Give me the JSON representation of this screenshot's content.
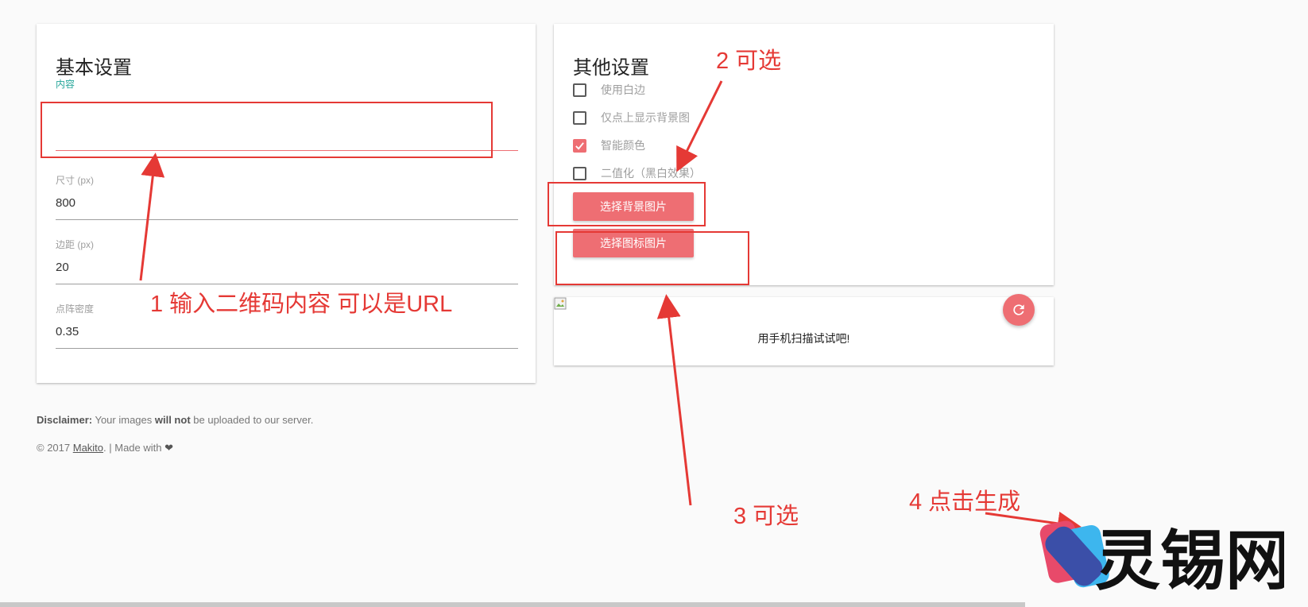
{
  "basic": {
    "title": "基本设置",
    "subtitle": "内容",
    "content_value": "",
    "size_label": "尺寸 (px)",
    "size_value": "800",
    "margin_label": "边距 (px)",
    "margin_value": "20",
    "density_label": "点阵密度",
    "density_value": "0.35"
  },
  "other": {
    "title": "其他设置",
    "options": [
      {
        "label": "使用白边",
        "checked": false
      },
      {
        "label": "仅点上显示背景图",
        "checked": false
      },
      {
        "label": "智能颜色",
        "checked": true
      },
      {
        "label": "二值化（黑白效果）",
        "checked": false
      }
    ],
    "btn_bg": "选择背景图片",
    "btn_logo": "选择图标图片"
  },
  "preview": {
    "caption": "用手机扫描试试吧!",
    "icons": {
      "refresh": "refresh-icon",
      "broken_image": "broken-image-icon"
    }
  },
  "footer": {
    "disclaimer_strong": "Disclaimer:",
    "disclaimer_text1": " Your images ",
    "disclaimer_strong2": "will not",
    "disclaimer_text2": " be uploaded to our server.",
    "copyright_text": "© 2017 ",
    "author": "Makito",
    "made_with": ". | Made with "
  },
  "annotations": {
    "a1": "1 输入二维码内容 可以是URL",
    "a2": "2 可选",
    "a3": "3 可选",
    "a4": "4 点击生成"
  },
  "watermark": {
    "text": "灵锡网"
  },
  "colors": {
    "accent": "#ee6e73",
    "teal": "#26a69a",
    "annotation": "#e53935"
  }
}
